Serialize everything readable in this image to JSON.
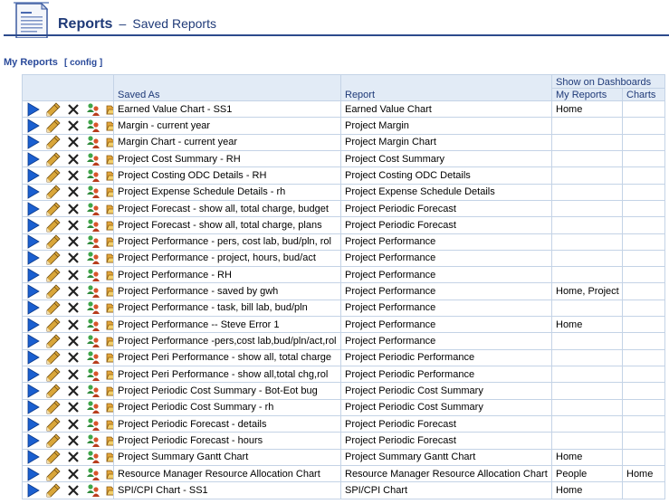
{
  "header": {
    "title": "Reports",
    "separator": "–",
    "subtitle": "Saved Reports",
    "icon": "document-icon"
  },
  "section": {
    "title": "My Reports",
    "config_label": "[ config ]"
  },
  "table": {
    "group_header": "Show on Dashboards",
    "columns": {
      "saved_as": "Saved As",
      "report": "Report",
      "my_reports": "My Reports",
      "charts": "Charts"
    },
    "action_icons": [
      "run-icon",
      "edit-pencil-icon",
      "delete-x-icon",
      "share-users-icon",
      "open-folder-icon"
    ],
    "rows": [
      {
        "saved_as": "Earned Value Chart - SS1",
        "report": "Earned Value Chart",
        "my_reports": "Home",
        "charts": ""
      },
      {
        "saved_as": "Margin - current year",
        "report": "Project Margin",
        "my_reports": "",
        "charts": ""
      },
      {
        "saved_as": "Margin Chart - current year",
        "report": "Project Margin Chart",
        "my_reports": "",
        "charts": ""
      },
      {
        "saved_as": "Project Cost Summary - RH",
        "report": "Project Cost Summary",
        "my_reports": "",
        "charts": ""
      },
      {
        "saved_as": "Project Costing ODC Details - RH",
        "report": "Project Costing ODC Details",
        "my_reports": "",
        "charts": ""
      },
      {
        "saved_as": "Project Expense Schedule Details - rh",
        "report": "Project Expense Schedule Details",
        "my_reports": "",
        "charts": ""
      },
      {
        "saved_as": "Project Forecast - show all, total charge, budget",
        "report": "Project Periodic Forecast",
        "my_reports": "",
        "charts": ""
      },
      {
        "saved_as": "Project Forecast - show all, total charge, plans",
        "report": "Project Periodic Forecast",
        "my_reports": "",
        "charts": ""
      },
      {
        "saved_as": "Project Performance - pers, cost lab, bud/pln, rol",
        "report": "Project Performance",
        "my_reports": "",
        "charts": ""
      },
      {
        "saved_as": "Project Performance - project, hours, bud/act",
        "report": "Project Performance",
        "my_reports": "",
        "charts": ""
      },
      {
        "saved_as": "Project Performance - RH",
        "report": "Project Performance",
        "my_reports": "",
        "charts": ""
      },
      {
        "saved_as": "Project Performance - saved by gwh",
        "report": "Project Performance",
        "my_reports": "Home, Project",
        "charts": ""
      },
      {
        "saved_as": "Project Performance - task, bill lab, bud/pln",
        "report": "Project Performance",
        "my_reports": "",
        "charts": ""
      },
      {
        "saved_as": "Project Performance -- Steve Error 1",
        "report": "Project Performance",
        "my_reports": "Home",
        "charts": ""
      },
      {
        "saved_as": "Project Performance -pers,cost lab,bud/pln/act,rol",
        "report": "Project Performance",
        "my_reports": "",
        "charts": ""
      },
      {
        "saved_as": "Project Peri Performance - show all, total charge",
        "report": "Project Periodic Performance",
        "my_reports": "",
        "charts": ""
      },
      {
        "saved_as": "Project Peri Performance - show all,total chg,rol",
        "report": "Project Periodic Performance",
        "my_reports": "",
        "charts": ""
      },
      {
        "saved_as": "Project Periodic Cost Summary - Bot-Eot bug",
        "report": "Project Periodic Cost Summary",
        "my_reports": "",
        "charts": ""
      },
      {
        "saved_as": "Project Periodic Cost Summary - rh",
        "report": "Project Periodic Cost Summary",
        "my_reports": "",
        "charts": ""
      },
      {
        "saved_as": "Project Periodic Forecast - details",
        "report": "Project Periodic Forecast",
        "my_reports": "",
        "charts": ""
      },
      {
        "saved_as": "Project Periodic Forecast - hours",
        "report": "Project Periodic Forecast",
        "my_reports": "",
        "charts": ""
      },
      {
        "saved_as": "Project Summary Gantt Chart",
        "report": "Project Summary Gantt Chart",
        "my_reports": "Home",
        "charts": ""
      },
      {
        "saved_as": "Resource Manager Resource Allocation Chart",
        "report": "Resource Manager Resource Allocation Chart",
        "my_reports": "People",
        "charts": "Home"
      },
      {
        "saved_as": "SPI/CPI Chart - SS1",
        "report": "SPI/CPI Chart",
        "my_reports": "Home",
        "charts": ""
      }
    ]
  },
  "colors": {
    "header_blue": "#1f3a78",
    "header_rule": "#2c4a8c",
    "table_header_bg": "#e2ebf6",
    "grid_line": "#c4d3e6",
    "run_icon": "#1a5fd0",
    "delete_icon": "#222222",
    "pencil_icon": "#c79a2a"
  }
}
